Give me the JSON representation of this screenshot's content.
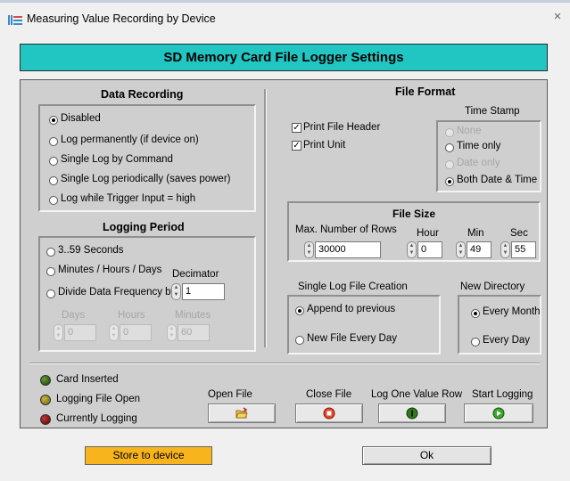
{
  "window": {
    "title": "Measuring Value Recording by Device",
    "close_glyph": "×"
  },
  "banner": {
    "title": "SD Memory Card File Logger Settings"
  },
  "data_recording": {
    "title": "Data Recording",
    "options": [
      "Disabled",
      "Log permanently (if device on)",
      "Single Log by Command",
      "Single Log periodically (saves power)",
      "Log while Trigger Input = high"
    ],
    "selected": "Disabled"
  },
  "logging_period": {
    "title": "Logging Period",
    "options": [
      "3..59 Seconds",
      "Minutes / Hours / Days",
      "Divide Data Frequency by"
    ],
    "decimator_label": "Decimator",
    "decimator_value": "1",
    "days_label": "Days",
    "days_value": "0",
    "hours_label": "Hours",
    "hours_value": "0",
    "minutes_label": "Minutes",
    "minutes_value": "60"
  },
  "file_format": {
    "title": "File Format",
    "print_file_header": "Print File Header",
    "print_unit": "Print Unit",
    "print_file_header_checked": true,
    "print_unit_checked": true,
    "time_stamp": {
      "title": "Time Stamp",
      "options": [
        "None",
        "Time only",
        "Date only",
        "Both Date & Time"
      ],
      "selected": "Both Date & Time"
    }
  },
  "file_size": {
    "title": "File Size",
    "max_rows_label": "Max. Number of Rows",
    "max_rows_value": "30000",
    "hour_label": "Hour",
    "hour_value": "0",
    "min_label": "Min",
    "min_value": "49",
    "sec_label": "Sec",
    "sec_value": "55"
  },
  "single_log": {
    "title": "Single Log File Creation",
    "options": [
      "Append to previous",
      "New File Every Day"
    ],
    "selected": "Append to previous"
  },
  "new_directory": {
    "title": "New Directory",
    "options": [
      "Every Month",
      "Every Day"
    ],
    "selected": "Every Month"
  },
  "status": {
    "card_inserted": "Card Inserted",
    "logging_file_open": "Logging File Open",
    "currently_logging": "Currently Logging",
    "colors": {
      "card": "#2f5a16",
      "file": "#8c7a14",
      "logging": "#7a1010"
    }
  },
  "actions": {
    "open_file": "Open File",
    "close_file": "Close File",
    "log_one_value_row": "Log One Value Row",
    "start_logging": "Start Logging"
  },
  "footer": {
    "store_to_device": "Store to device",
    "ok": "Ok",
    "store_color": "#f7b41c"
  },
  "colors": {
    "banner": "#21c6c3",
    "panel": "#cfcfcf"
  }
}
